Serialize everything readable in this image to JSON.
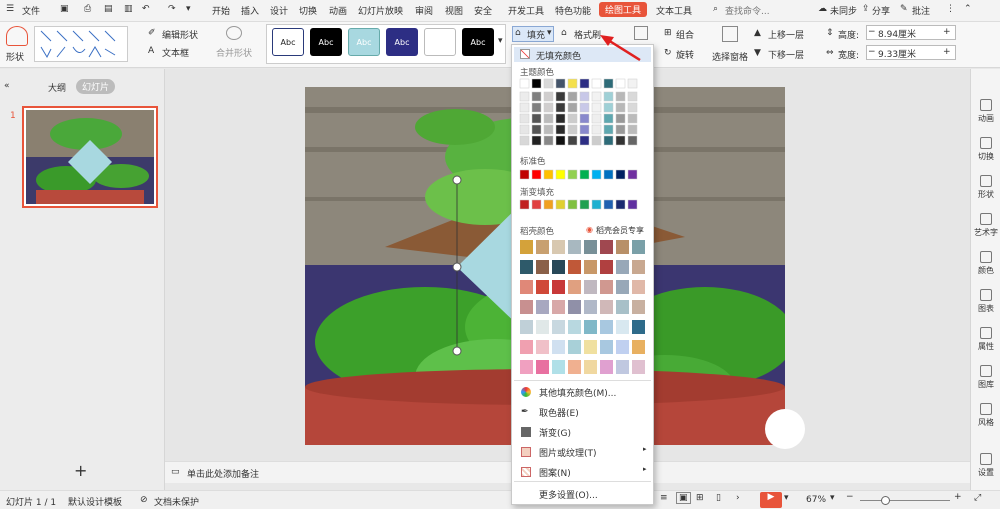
{
  "menu": {
    "file": "文件",
    "items": [
      "开始",
      "插入",
      "设计",
      "切换",
      "动画",
      "幻灯片放映",
      "审阅",
      "视图",
      "安全",
      "开发工具",
      "特色功能"
    ],
    "active_tab": "绘图工具",
    "text_tools": "文本工具",
    "search": "查找命令...",
    "sync": "未同步",
    "share": "分享",
    "comment": "批注"
  },
  "ribbon": {
    "shape": "形状",
    "edit_shape": "编辑形状",
    "textbox": "文本框",
    "merge_shape": "合并形状",
    "style_label": "Abc",
    "fill": "填充",
    "format_brush": "格式刷",
    "group": "组合",
    "rotate": "旋转",
    "select_pane": "选择窗格",
    "bring_forward": "上移一层",
    "send_backward": "下移一层",
    "height_label": "高度:",
    "height_value": "8.94厘米",
    "width_label": "宽度:",
    "width_value": "9.33厘米"
  },
  "left_panel": {
    "tab_outline": "大纲",
    "tab_slides": "幻灯片",
    "slide_number": "1",
    "add": "+"
  },
  "notes": {
    "placeholder": "单击此处添加备注"
  },
  "right_bar": [
    "动画",
    "切换",
    "形状",
    "艺术字",
    "颜色",
    "图表",
    "属性",
    "图库",
    "风格",
    "设置"
  ],
  "status": {
    "slide_info": "幻灯片 1 / 1",
    "template": "默认设计模板",
    "protect": "文档未保护",
    "zoom": "67%"
  },
  "dropdown": {
    "no_fill": "无填充颜色",
    "theme_colors": "主题颜色",
    "standard_colors": "标准色",
    "gradient_fill": "渐变填充",
    "daoke_colors": "稻壳颜色",
    "member_exclusive": "稻壳会员专享",
    "more_fill": "其他填充颜色(M)...",
    "eyedropper": "取色器(E)",
    "gradient": "渐变(G)",
    "picture_texture": "图片或纹理(T)",
    "pattern": "图案(N)",
    "more_settings": "更多设置(O)..."
  },
  "colors": {
    "accent": "#e8543a",
    "diamond": "#a8d8e0"
  }
}
